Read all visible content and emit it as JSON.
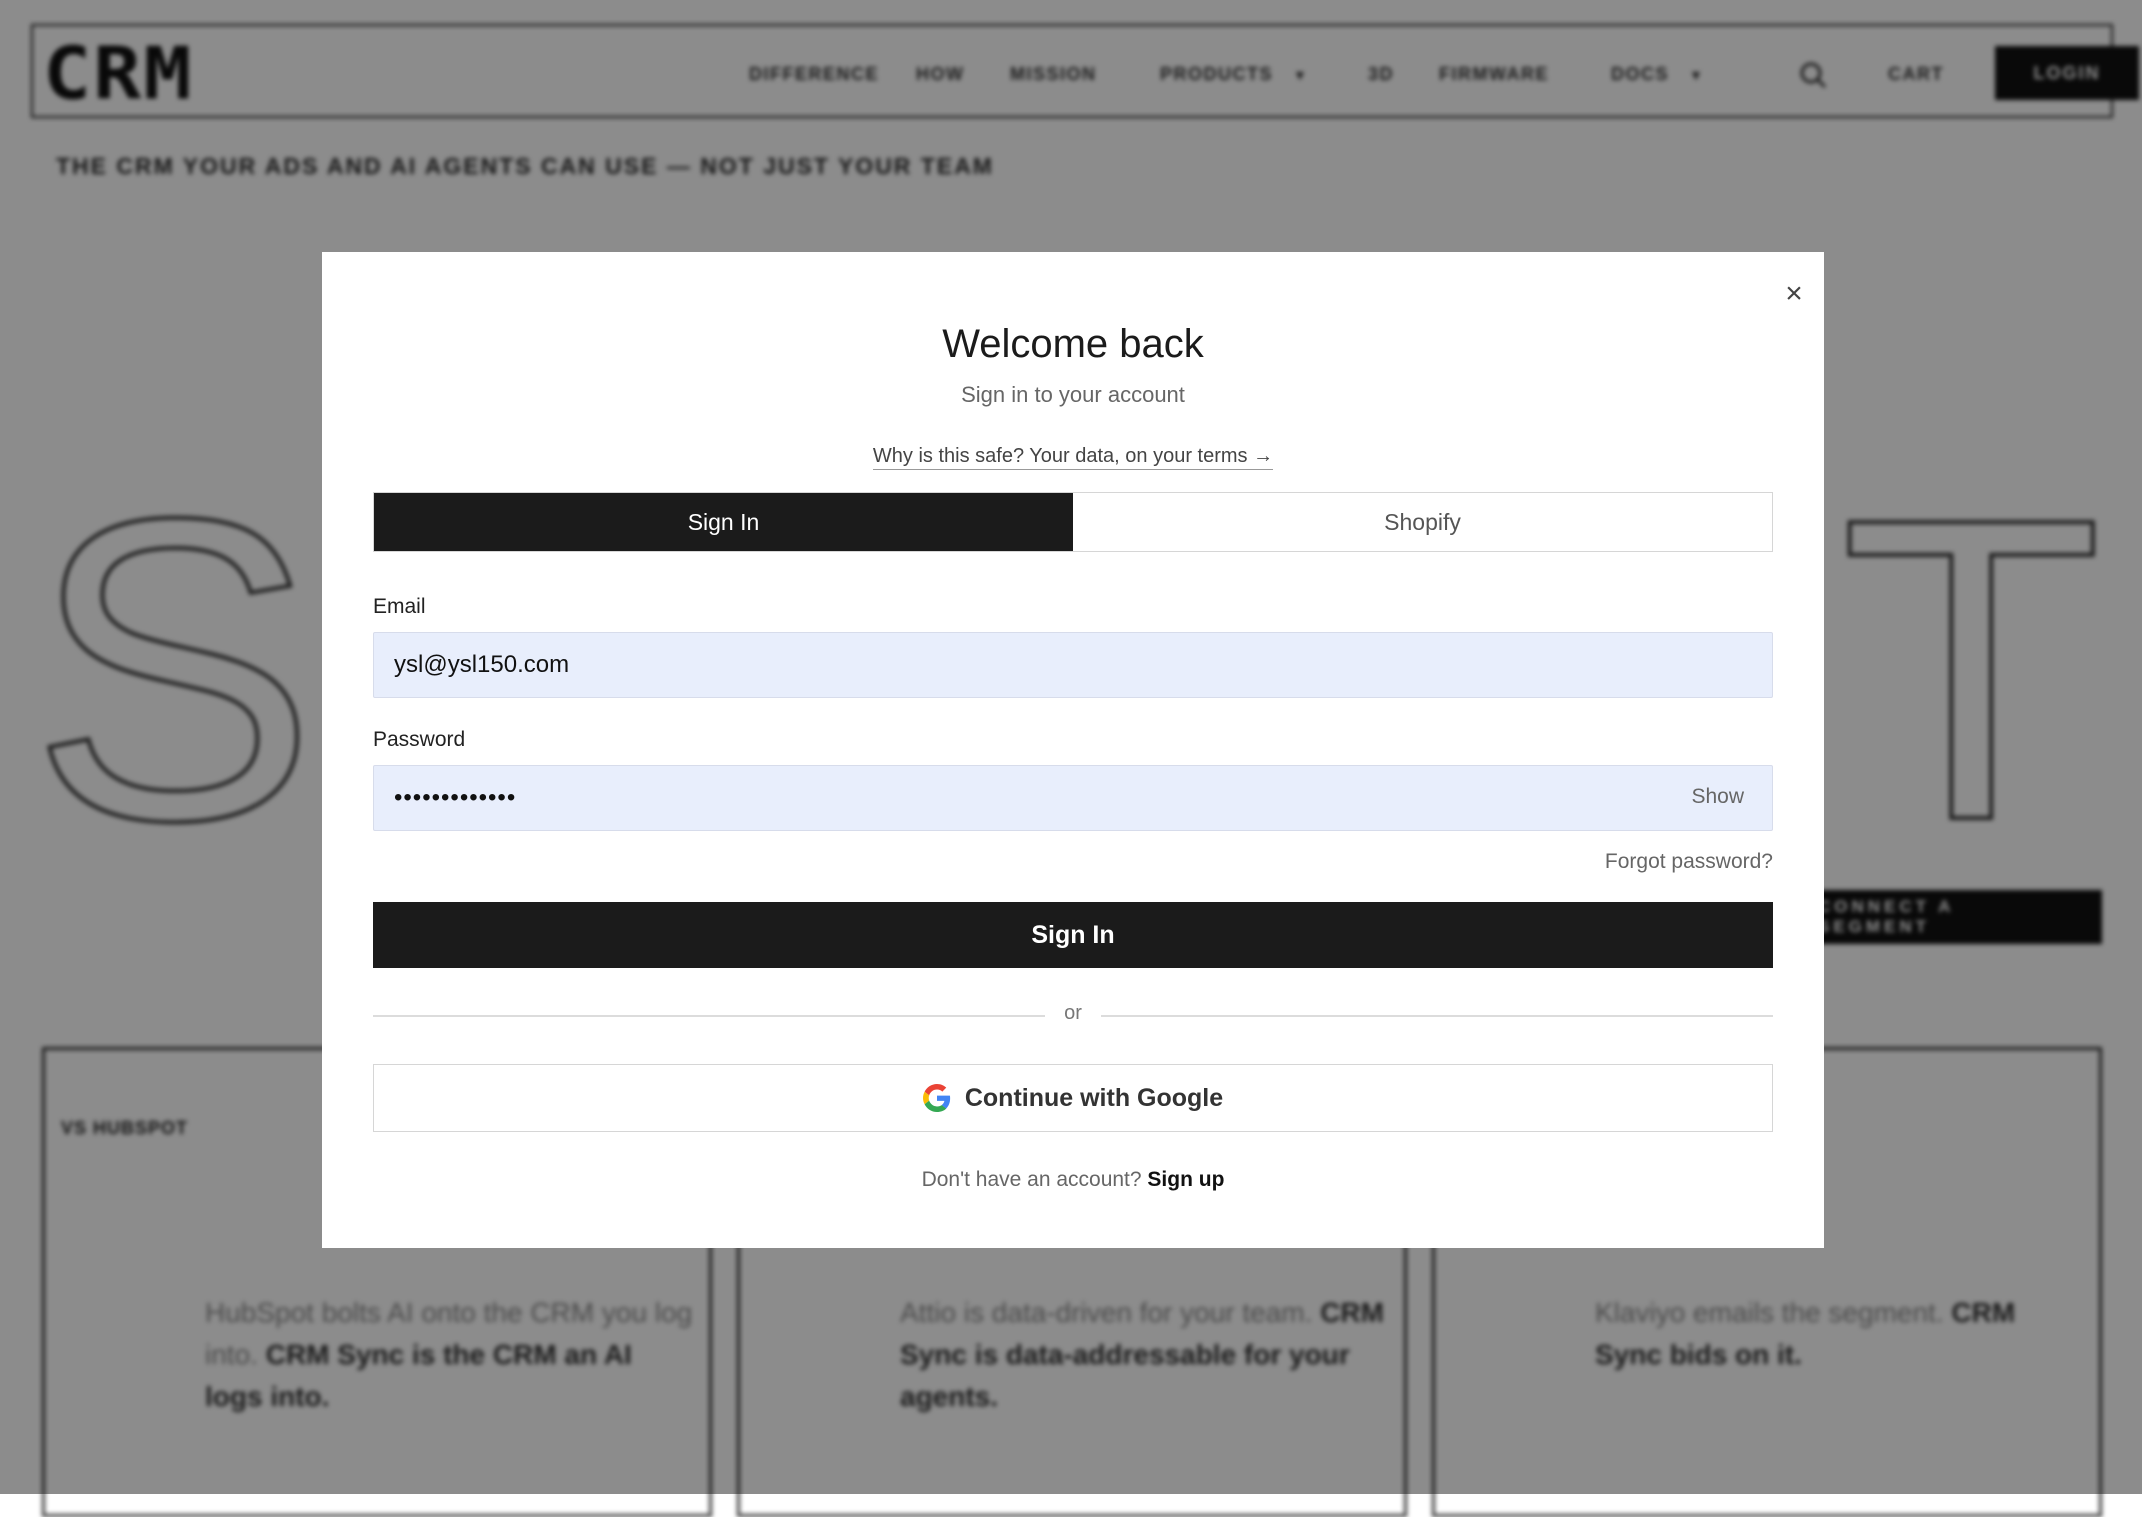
{
  "background": {
    "logo": "CRM",
    "nav": [
      {
        "label": "DIFFERENCE"
      },
      {
        "label": "HOW"
      },
      {
        "label": "MISSION"
      },
      {
        "label": "PRODUCTS"
      },
      {
        "label": "3D"
      },
      {
        "label": "FIRMWARE"
      },
      {
        "label": "DOCS"
      }
    ],
    "cart": "CART",
    "login": "LOGIN",
    "tagline": "THE CRM YOUR ADS AND AI AGENTS CAN USE — NOT JUST YOUR TEAM",
    "big_left": "S",
    "big_right": "T",
    "cta": "CONNECT A SEGMENT",
    "cards": [
      {
        "tag": "VS  HUBSPOT",
        "text": "HubSpot bolts AI onto the CRM you log into.",
        "bold": "CRM Sync is the CRM an AI logs into."
      },
      {
        "tag": "",
        "text": "Attio is data-driven for your team.",
        "bold": "CRM Sync is data-addressable for your agents."
      },
      {
        "tag": "",
        "text": "Klaviyo emails the segment.",
        "bold": "CRM Sync bids on it."
      }
    ]
  },
  "modal": {
    "close": "×",
    "title": "Welcome back",
    "subtitle": "Sign in to your account",
    "safe_link": "Why is this safe? Your data, on your terms →",
    "tabs": [
      {
        "label": "Sign In",
        "active": true
      },
      {
        "label": "Shopify",
        "active": false
      }
    ],
    "email_label": "Email",
    "email_value": "ysl@ysl150.com",
    "password_label": "Password",
    "password_value": "•••••••••••••",
    "show_label": "Show",
    "forgot": "Forgot password?",
    "submit": "Sign In",
    "or": "or",
    "google": "Continue with Google",
    "no_account": "Don't have an account?",
    "signup": "Sign up"
  },
  "colors": {
    "primary": "#1b1b1b",
    "input_bg": "#e8eefc",
    "overlay": "rgba(0,0,0,0.45)"
  }
}
